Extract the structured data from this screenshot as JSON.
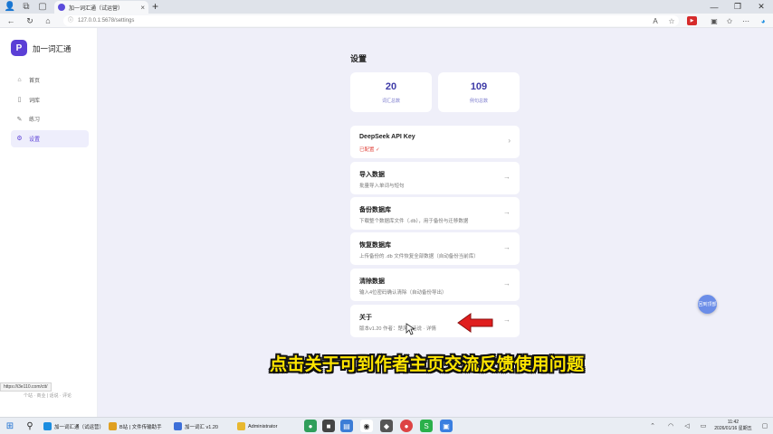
{
  "browser": {
    "tab_title": "加一词汇通（试运营）",
    "tab_close": "×",
    "new_tab": "+",
    "url": "127.0.0.1:5678/settings",
    "status_url": "https://i3e110.com/ctt/",
    "window_controls": [
      "—",
      "❐",
      "✕"
    ]
  },
  "sidebar": {
    "logo_letter": "P",
    "app_name": "加一词汇通",
    "items": [
      {
        "icon": "home-icon",
        "glyph": "⌂",
        "label": "首页",
        "active": false
      },
      {
        "icon": "book-icon",
        "glyph": "▯",
        "label": "词库",
        "active": false
      },
      {
        "icon": "pencil-icon",
        "glyph": "✎",
        "label": "练习",
        "active": false
      },
      {
        "icon": "gear-icon",
        "glyph": "⚙",
        "label": "设置",
        "active": true
      }
    ],
    "footer": "个站 · 商业 | 话说 · 评论"
  },
  "main": {
    "title": "设置",
    "stats": [
      {
        "value": "20",
        "label": "词汇总数"
      },
      {
        "value": "109",
        "label": "例句总数"
      }
    ],
    "cards": [
      {
        "title": "DeepSeek API Key",
        "desc": "已配置 ✓",
        "desc_ok": true
      },
      {
        "title": "导入数据",
        "desc": "批量导入单词与短句",
        "desc_ok": false
      },
      {
        "title": "备份数据库",
        "desc": "下载整个数据库文件（.db），用于备份与迁移数据",
        "desc_ok": false
      },
      {
        "title": "恢复数据库",
        "desc": "上传备份的 .db 文件恢复全部数据（自动备份当前库）",
        "desc_ok": false
      },
      {
        "title": "清除数据",
        "desc": "输入4位密码确认清除（自动备份导出）",
        "desc_ok": false
      },
      {
        "title": "关于",
        "desc": "版本v1.20 作者：楚风 | 话说 · 详情",
        "desc_ok": false
      }
    ],
    "card_arrow": "→",
    "float_button": "回到顶部"
  },
  "caption": "点击关于可到作者主页交流反馈使用问题",
  "taskbar": {
    "apps": [
      "加一词汇通（试运营）",
      "B站 | 文件传输助手",
      "加一词汇 v1.20",
      "Administrator"
    ],
    "time": "11:42",
    "date": "2026/01/16 星期五"
  },
  "colors": {
    "accent": "#5b3fd6",
    "stat_number": "#3d3aa7",
    "page_background": "#efeff9",
    "ok_text": "#e0443c",
    "caption_yellow": "#ffe600",
    "annotation_arrow": "#e01e1e"
  }
}
